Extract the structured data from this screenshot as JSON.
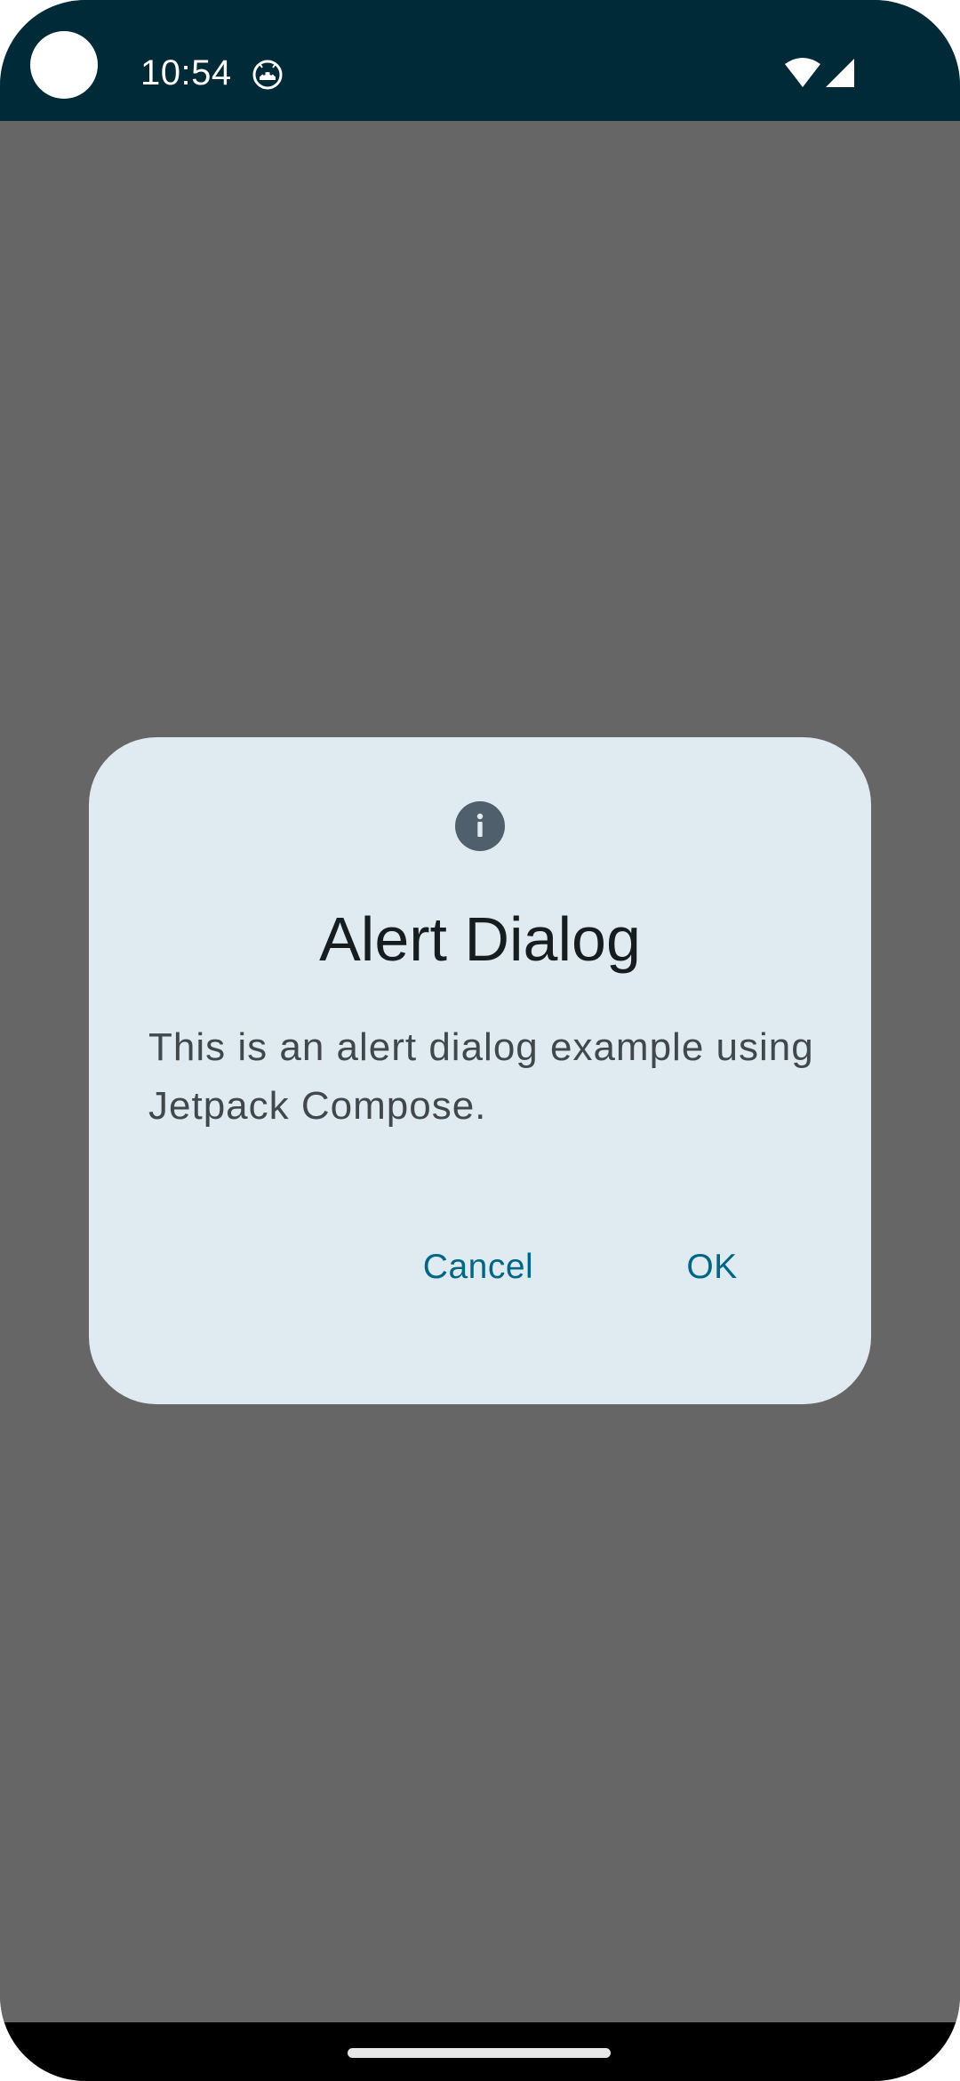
{
  "status_bar": {
    "time": "10:54",
    "notification_icon": "android-debug-icon",
    "wifi_icon": "wifi-icon",
    "signal_icon": "cell-signal-icon",
    "background_color": "#002A38"
  },
  "dialog": {
    "icon": "info-icon",
    "title": "Alert Dialog",
    "message": "This is an alert dialog example using Jetpack Compose.",
    "cancel_label": "Cancel",
    "ok_label": "OK",
    "background_color": "#DFEAF1",
    "accent_color": "#006685"
  },
  "scrim_color": "#666666"
}
